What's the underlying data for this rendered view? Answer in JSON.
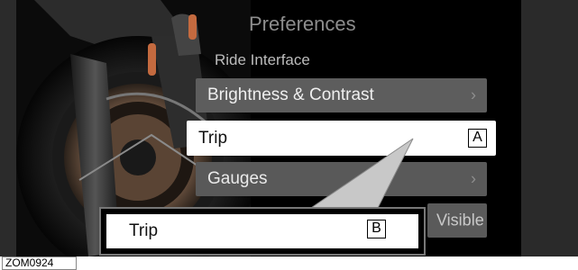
{
  "screen": {
    "title": "Preferences",
    "section_label": "Ride Interface",
    "menu": [
      {
        "label": "Brightness & Contrast",
        "chevron": "›",
        "state": "normal"
      },
      {
        "label": "Trip",
        "state": "selected"
      },
      {
        "label": "Gauges",
        "chevron": "›",
        "state": "normal"
      },
      {
        "label": "Visible",
        "state": "partially-hidden"
      }
    ]
  },
  "callouts": {
    "a": "A",
    "b": "B"
  },
  "zoom_detail": {
    "label": "Trip"
  },
  "figure_id": "ZOM0924",
  "colors": {
    "background": "#000000",
    "menu_item": "#5d5d5d",
    "selected_item": "#ffffff",
    "title_text": "#8d8d8d"
  }
}
